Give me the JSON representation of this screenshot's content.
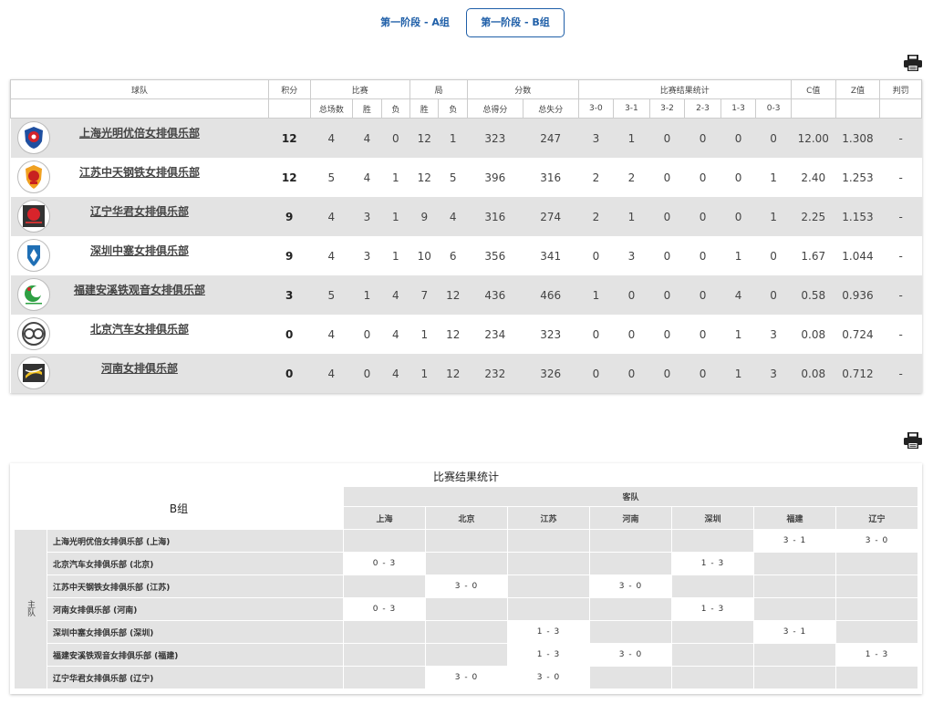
{
  "tabs": [
    {
      "label": "第一阶段 - A组",
      "active": false
    },
    {
      "label": "第一阶段 - B组",
      "active": true
    }
  ],
  "standings": {
    "headers": {
      "team": "球队",
      "points": "积分",
      "matches": "比赛",
      "sets": "局",
      "score": "分数",
      "result_stats": "比赛结果统计",
      "c_value": "C值",
      "z_value": "Z值",
      "penalty": "判罚",
      "total_matches": "总场数",
      "win": "胜",
      "loss": "负",
      "set_win": "胜",
      "set_loss": "负",
      "points_for": "总得分",
      "points_against": "总失分",
      "r30": "3-0",
      "r31": "3-1",
      "r32": "3-2",
      "r23": "2-3",
      "r13": "1-3",
      "r03": "0-3"
    },
    "rows": [
      {
        "team": "上海光明优倍女排俱乐部",
        "logo": "shanghai-logo-icon",
        "points": "12",
        "total": "4",
        "win": "4",
        "loss": "0",
        "sw": "12",
        "sl": "1",
        "pf": "323",
        "pa": "247",
        "r30": "3",
        "r31": "1",
        "r32": "0",
        "r23": "0",
        "r13": "0",
        "r03": "0",
        "c": "12.00",
        "z": "1.308",
        "penalty": "-"
      },
      {
        "team": "江苏中天钢铁女排俱乐部",
        "logo": "jiangsu-logo-icon",
        "points": "12",
        "total": "5",
        "win": "4",
        "loss": "1",
        "sw": "12",
        "sl": "5",
        "pf": "396",
        "pa": "316",
        "r30": "2",
        "r31": "2",
        "r32": "0",
        "r23": "0",
        "r13": "0",
        "r03": "1",
        "c": "2.40",
        "z": "1.253",
        "penalty": "-"
      },
      {
        "team": "辽宁华君女排俱乐部",
        "logo": "liaoning-logo-icon",
        "points": "9",
        "total": "4",
        "win": "3",
        "loss": "1",
        "sw": "9",
        "sl": "4",
        "pf": "316",
        "pa": "274",
        "r30": "2",
        "r31": "1",
        "r32": "0",
        "r23": "0",
        "r13": "0",
        "r03": "1",
        "c": "2.25",
        "z": "1.153",
        "penalty": "-"
      },
      {
        "team": "深圳中塞女排俱乐部",
        "logo": "shenzhen-logo-icon",
        "points": "9",
        "total": "4",
        "win": "3",
        "loss": "1",
        "sw": "10",
        "sl": "6",
        "pf": "356",
        "pa": "341",
        "r30": "0",
        "r31": "3",
        "r32": "0",
        "r23": "0",
        "r13": "1",
        "r03": "0",
        "c": "1.67",
        "z": "1.044",
        "penalty": "-"
      },
      {
        "team": "福建安溪铁观音女排俱乐部",
        "logo": "fujian-logo-icon",
        "points": "3",
        "total": "5",
        "win": "1",
        "loss": "4",
        "sw": "7",
        "sl": "12",
        "pf": "436",
        "pa": "466",
        "r30": "1",
        "r31": "0",
        "r32": "0",
        "r23": "0",
        "r13": "4",
        "r03": "0",
        "c": "0.58",
        "z": "0.936",
        "penalty": "-"
      },
      {
        "team": "北京汽车女排俱乐部",
        "logo": "beijing-logo-icon",
        "points": "0",
        "total": "4",
        "win": "0",
        "loss": "4",
        "sw": "1",
        "sl": "12",
        "pf": "234",
        "pa": "323",
        "r30": "0",
        "r31": "0",
        "r32": "0",
        "r23": "0",
        "r13": "1",
        "r03": "3",
        "c": "0.08",
        "z": "0.724",
        "penalty": "-"
      },
      {
        "team": "河南女排俱乐部",
        "logo": "henan-logo-icon",
        "points": "0",
        "total": "4",
        "win": "0",
        "loss": "4",
        "sw": "1",
        "sl": "12",
        "pf": "232",
        "pa": "326",
        "r30": "0",
        "r31": "0",
        "r32": "0",
        "r23": "0",
        "r13": "1",
        "r03": "3",
        "c": "0.08",
        "z": "0.712",
        "penalty": "-"
      }
    ]
  },
  "matrix": {
    "title": "比赛结果统计",
    "group": "B组",
    "away_label": "客队",
    "home_label": "主队",
    "columns": [
      "上海",
      "北京",
      "江苏",
      "河南",
      "深圳",
      "福建",
      "辽宁"
    ],
    "rows": [
      {
        "name": "上海光明优倍女排俱乐部 (上海)",
        "cells": [
          "",
          "",
          "",
          "",
          "",
          "3 - 1",
          "3 - 0"
        ]
      },
      {
        "name": "北京汽车女排俱乐部 (北京)",
        "cells": [
          "0 - 3",
          "",
          "",
          "",
          "1 - 3",
          "",
          ""
        ]
      },
      {
        "name": "江苏中天钢铁女排俱乐部 (江苏)",
        "cells": [
          "",
          "3 - 0",
          "",
          "3 - 0",
          "",
          "",
          ""
        ]
      },
      {
        "name": "河南女排俱乐部 (河南)",
        "cells": [
          "0 - 3",
          "",
          "",
          "",
          "1 - 3",
          "",
          ""
        ]
      },
      {
        "name": "深圳中塞女排俱乐部 (深圳)",
        "cells": [
          "",
          "",
          "1 - 3",
          "",
          "",
          "3 - 1",
          ""
        ]
      },
      {
        "name": "福建安溪铁观音女排俱乐部 (福建)",
        "cells": [
          "",
          "",
          "1 - 3",
          "3 - 0",
          "",
          "",
          "1 - 3"
        ]
      },
      {
        "name": "辽宁华君女排俱乐部 (辽宁)",
        "cells": [
          "",
          "3 - 0",
          "3 - 0",
          "",
          "",
          "",
          ""
        ]
      }
    ]
  }
}
